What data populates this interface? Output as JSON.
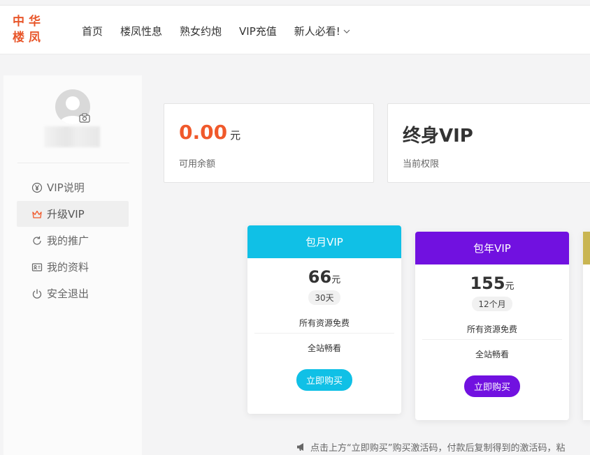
{
  "logo": {
    "line1": "中华",
    "line2": "楼凤"
  },
  "nav": {
    "items": [
      "首页",
      "楼凤性息",
      "熟女约炮",
      "VIP充值",
      "新人必看!"
    ]
  },
  "sidebar": {
    "menu": [
      {
        "label": "VIP说明",
        "icon": "yen-circle-icon"
      },
      {
        "label": "升级VIP",
        "icon": "crown-icon",
        "active": true
      },
      {
        "label": "我的推广",
        "icon": "refresh-icon"
      },
      {
        "label": "我的资料",
        "icon": "id-card-icon"
      },
      {
        "label": "安全退出",
        "icon": "power-icon"
      }
    ]
  },
  "balance": {
    "value": "0.00",
    "unit": "元",
    "label": "可用余额"
  },
  "vip_status": {
    "value": "终身VIP",
    "label": "当前权限"
  },
  "plans": [
    {
      "name": "包月VIP",
      "price": "66",
      "unit": "元",
      "duration": "30天",
      "feature1": "所有资源免费",
      "feature2": "全站畅看",
      "button": "立即购买",
      "color": "#10c0e6"
    },
    {
      "name": "包年VIP",
      "price": "155",
      "unit": "元",
      "duration": "12个月",
      "feature1": "所有资源免费",
      "feature2": "全站畅看",
      "button": "立即购买",
      "color": "#7111e0"
    }
  ],
  "notice": "点击上方“立即购买”购买激活码，付款后复制得到的激活码，粘",
  "colors": {
    "accent": "#f0592b",
    "logo": "#e8562a",
    "third_plan": "#c9b552"
  }
}
